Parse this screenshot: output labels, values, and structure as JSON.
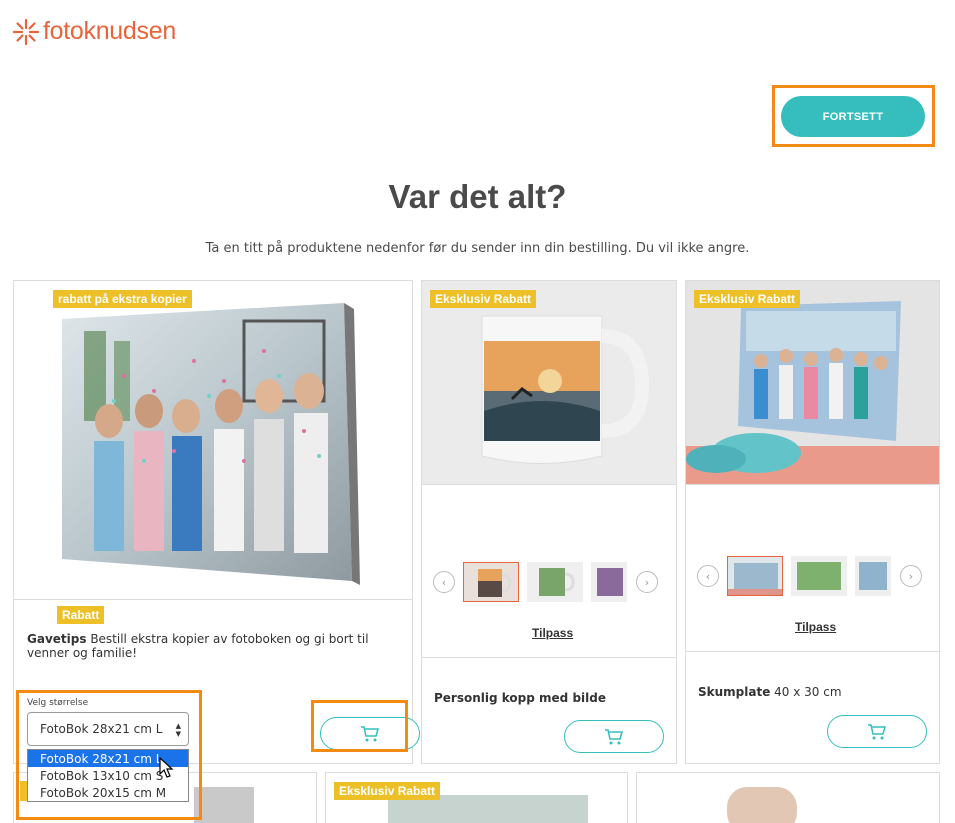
{
  "header": {
    "logo_text": "fotoknudsen",
    "continue_label": "FORTSETT"
  },
  "main": {
    "title": "Var det alt?",
    "subtitle": "Ta en titt på produktene nedenfor før du sender inn din bestilling. Du vil ikke angre."
  },
  "cards": [
    {
      "badge": "rabatt på ekstra kopier",
      "tag": "Rabatt",
      "desc_bold": "Gavetips",
      "desc_text": " Bestill ekstra kopier av fotoboken og gi bort til venner og familie!",
      "select_label": "Velg størrelse",
      "selected": "FotoBok 28x21 cm L",
      "options": [
        "FotoBok 28x21 cm L",
        "FotoBok 13x10 cm S",
        "FotoBok 20x15 cm M"
      ]
    },
    {
      "badge": "Eksklusiv Rabatt",
      "customize": "Tilpass",
      "name_bold": "Personlig kopp med bilde",
      "name_text": ""
    },
    {
      "badge": "Eksklusiv Rabatt",
      "customize": "Tilpass",
      "name_bold": "Skumplate",
      "name_text": " 40 x 30 cm"
    }
  ],
  "row2": [
    {
      "badge": ""
    },
    {
      "badge": "Eksklusiv Rabatt"
    },
    {
      "badge": ""
    }
  ],
  "icons": {
    "cart": "cart-icon",
    "prev": "chevron-left-icon",
    "next": "chevron-right-icon"
  },
  "colors": {
    "brand": "#e8643c",
    "accent": "#36bdbe",
    "badge": "#eec027",
    "highlight": "#f28a13"
  }
}
